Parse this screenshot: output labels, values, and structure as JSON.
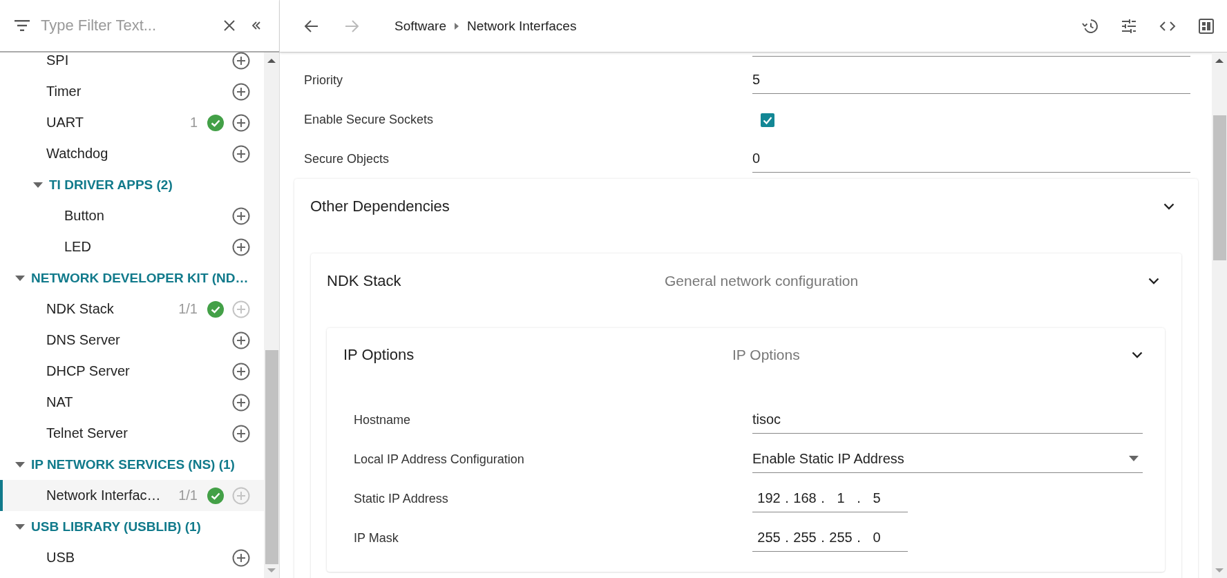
{
  "filter": {
    "placeholder": "Type Filter Text..."
  },
  "sidebar": {
    "items": [
      {
        "children": [
          {
            "label": "SPI",
            "add_enabled": true,
            "selected": false
          },
          {
            "label": "Timer",
            "add_enabled": true,
            "selected": false
          },
          {
            "label": "UART",
            "count": "1",
            "configured": true,
            "add_enabled": true,
            "selected": false
          },
          {
            "label": "Watchdog",
            "add_enabled": true,
            "selected": false
          },
          {
            "label": "TI DRIVER APPS (2)",
            "expanded": true,
            "children": [
              {
                "label": "Button",
                "add_enabled": true,
                "selected": false
              },
              {
                "label": "LED",
                "add_enabled": true,
                "selected": false
              }
            ]
          }
        ]
      },
      {
        "label": "NETWORK DEVELOPER KIT (ND…",
        "expanded": true,
        "children": [
          {
            "label": "NDK Stack",
            "count": "1/1",
            "configured": true,
            "add_enabled": false,
            "selected": false
          },
          {
            "label": "DNS Server",
            "add_enabled": true,
            "selected": false
          },
          {
            "label": "DHCP Server",
            "add_enabled": true,
            "selected": false
          },
          {
            "label": "NAT",
            "add_enabled": true,
            "selected": false
          },
          {
            "label": "Telnet Server",
            "add_enabled": true,
            "selected": false
          }
        ]
      },
      {
        "label": "IP NETWORK SERVICES (NS) (1)",
        "expanded": true,
        "children": [
          {
            "label": "Network Interfac…",
            "count": "1/1",
            "configured": true,
            "add_enabled": false,
            "selected": true
          }
        ]
      },
      {
        "label": "USB LIBRARY (USBLIB) (1)",
        "expanded": true,
        "children": [
          {
            "label": "USB",
            "add_enabled": true,
            "selected": false
          }
        ]
      }
    ]
  },
  "header": {
    "back_enabled": true,
    "forward_enabled": false,
    "breadcrumb": [
      "Software",
      "Network Interfaces"
    ]
  },
  "settings": [
    {
      "kind": "text",
      "label": "Priority",
      "value": "5"
    },
    {
      "kind": "checkbox",
      "label": "Enable Secure Sockets",
      "checked": true
    },
    {
      "kind": "text",
      "label": "Secure Objects",
      "value": "0"
    }
  ],
  "sections": [
    {
      "title": "Other Dependencies",
      "expanded": true,
      "children": [
        {
          "title": "NDK Stack",
          "description": "General network configuration",
          "expanded": true,
          "children": [
            {
              "title": "IP Options",
              "description": "IP Options",
              "expanded": true,
              "settings": [
                {
                  "kind": "text",
                  "label": "Hostname",
                  "value": "tisoc"
                },
                {
                  "kind": "dropdown",
                  "label": "Local IP Address Configuration",
                  "value": "Enable Static IP Address"
                },
                {
                  "kind": "ip",
                  "label": "Static IP Address",
                  "octets": [
                    "192",
                    "168",
                    "1",
                    "5"
                  ],
                  "separator": "."
                },
                {
                  "kind": "ip",
                  "label": "IP Mask",
                  "octets": [
                    "255",
                    "255",
                    "255",
                    "0"
                  ],
                  "separator": "."
                }
              ]
            }
          ]
        }
      ]
    }
  ]
}
